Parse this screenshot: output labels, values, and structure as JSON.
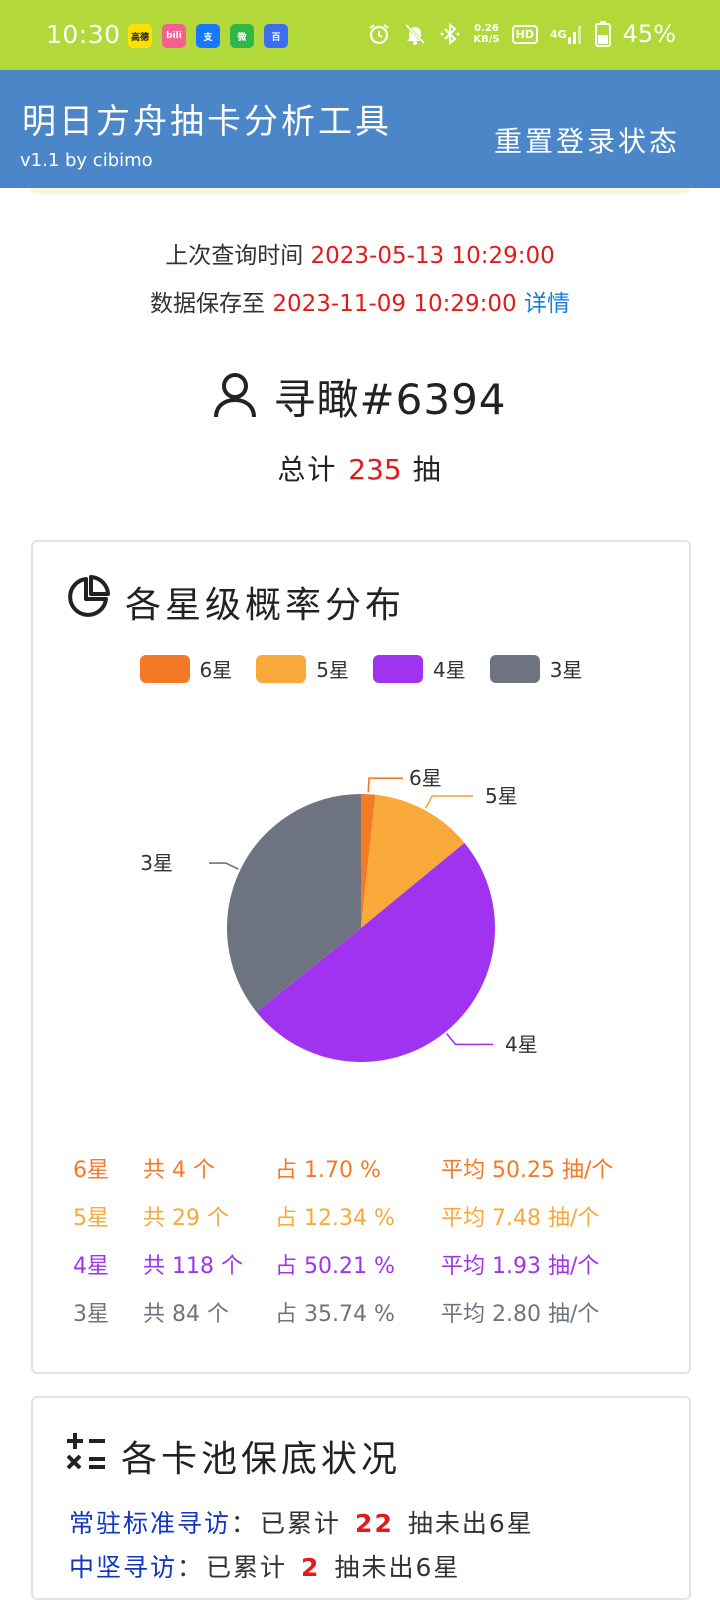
{
  "status_bar": {
    "time": "10:30",
    "app_icons": [
      {
        "name": "gaode-app-icon",
        "label": "高德",
        "bg": "#ffe000",
        "fg": "#222"
      },
      {
        "name": "bilibili-app-icon",
        "label": "bili",
        "bg": "#f45f8d",
        "fg": "#fff"
      },
      {
        "name": "alipay-app-icon",
        "label": "支",
        "bg": "#1677ff",
        "fg": "#fff"
      },
      {
        "name": "wechat-app-icon",
        "label": "微",
        "bg": "#2fb84a",
        "fg": "#fff"
      },
      {
        "name": "baidu-app-icon",
        "label": "百",
        "bg": "#3b6ef0",
        "fg": "#fff"
      }
    ],
    "net_speed_value": "0.26",
    "net_speed_unit": "KB/S",
    "hd": "HD",
    "network": "4G",
    "battery": "45%",
    "bg_color": "#b3d83a"
  },
  "header": {
    "title": "明日方舟抽卡分析工具",
    "version": "v1.1 by cibimo",
    "reset_label": "重置登录状态",
    "bg_color": "#4a86c8"
  },
  "query": {
    "last_query_label": "上次查询时间",
    "last_query_time": "2023-05-13 10:29:00",
    "saved_until_label": "数据保存至",
    "saved_until_time": "2023-11-09 10:29:00",
    "details_link": "详情"
  },
  "user": {
    "name": "寻瞰#6394",
    "total_prefix": "总计",
    "total_pulls": "235",
    "total_suffix": "抽"
  },
  "distribution_card": {
    "title": "各星级概率分布",
    "legend": [
      {
        "label": "6星",
        "color": "#f47a25"
      },
      {
        "label": "5星",
        "color": "#f8a93a"
      },
      {
        "label": "4星",
        "color": "#a033f0"
      },
      {
        "label": "3星",
        "color": "#6d7480"
      }
    ],
    "rows": [
      {
        "star": "6星",
        "count": "共 4 个",
        "pct": "占 1.70 %",
        "avg": "平均 50.25 抽/个",
        "color": "#f47a25"
      },
      {
        "star": "5星",
        "count": "共 29 个",
        "pct": "占 12.34 %",
        "avg": "平均 7.48 抽/个",
        "color": "#f8a93a"
      },
      {
        "star": "4星",
        "count": "共 118 个",
        "pct": "占 50.21 %",
        "avg": "平均 1.93 抽/个",
        "color": "#a033f0"
      },
      {
        "star": "3星",
        "count": "共 84 个",
        "pct": "占 35.74 %",
        "avg": "平均 2.80 抽/个",
        "color": "#6d7480"
      }
    ]
  },
  "chart_data": {
    "type": "pie",
    "title": "各星级概率分布",
    "categories": [
      "6星",
      "5星",
      "4星",
      "3星"
    ],
    "values": [
      4,
      29,
      118,
      84
    ],
    "colors": [
      "#f47a25",
      "#f8a93a",
      "#a033f0",
      "#6d7480"
    ],
    "legend_position": "top"
  },
  "guarantee_card": {
    "title": "各卡池保底状况",
    "rows": [
      {
        "pool": "常驻标准寻访",
        "sep": "：",
        "prefix": "已累计",
        "count": "22",
        "suffix": "抽未出6星"
      },
      {
        "pool": "中坚寻访",
        "sep": "：",
        "prefix": "已累计",
        "count": "2",
        "suffix": "抽未出6星"
      }
    ]
  }
}
